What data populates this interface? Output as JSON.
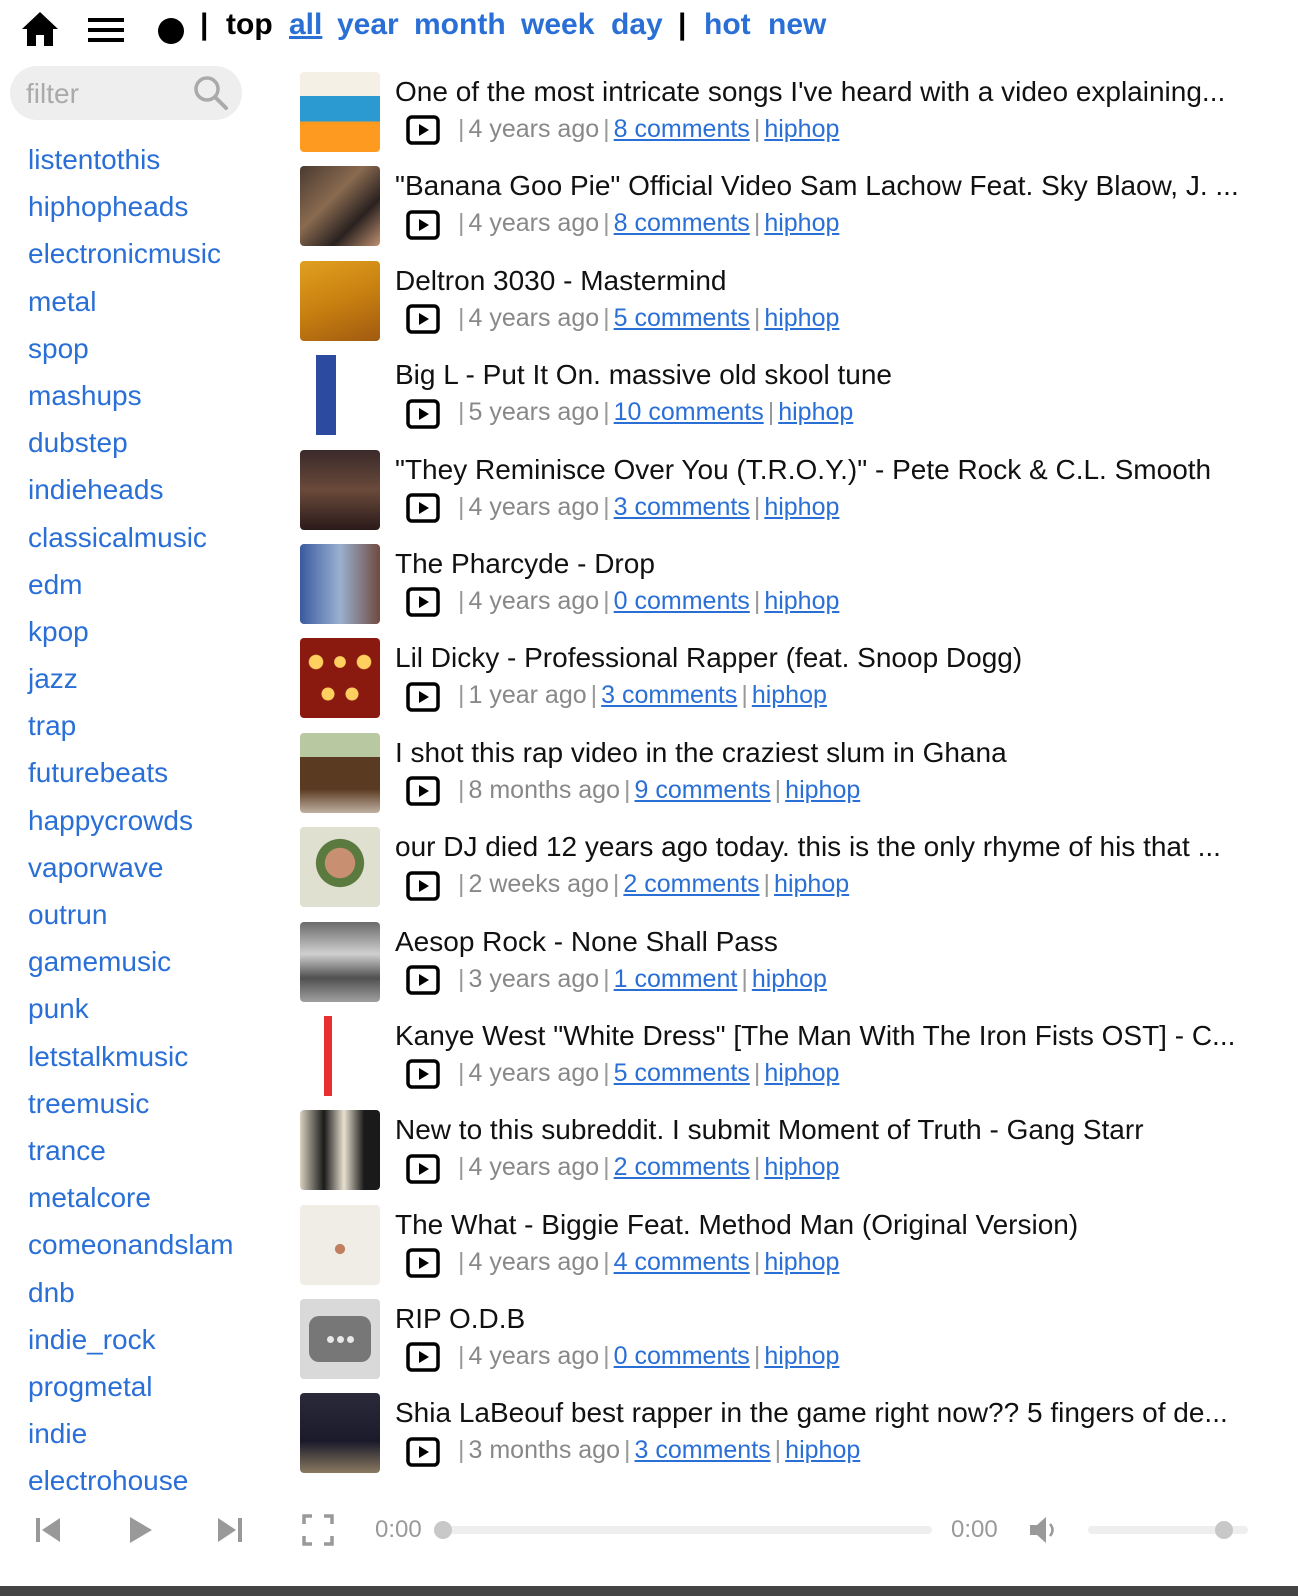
{
  "nav": {
    "separator": "|",
    "top_label": "top",
    "periods": [
      "all",
      "year",
      "month",
      "week",
      "day"
    ],
    "active_period": "all",
    "sorts": [
      "hot",
      "new"
    ]
  },
  "filter": {
    "placeholder": "filter",
    "value": ""
  },
  "subreddits": [
    "listentothis",
    "hiphopheads",
    "electronicmusic",
    "metal",
    "spop",
    "mashups",
    "dubstep",
    "indieheads",
    "classicalmusic",
    "edm",
    "kpop",
    "jazz",
    "trap",
    "futurebeats",
    "happycrowds",
    "vaporwave",
    "outrun",
    "gamemusic",
    "punk",
    "letstalkmusic",
    "treemusic",
    "trance",
    "metalcore",
    "comeonandslam",
    "dnb",
    "indie_rock",
    "progmetal",
    "indie",
    "electrohouse"
  ],
  "posts": [
    {
      "title": "One of the most intricate songs I've heard with a video explaining...",
      "age": "4 years ago",
      "comments": "8 comments",
      "sub": "hiphop"
    },
    {
      "title": "\"Banana Goo Pie\" Official Video Sam Lachow Feat. Sky Blaow, J. ...",
      "age": "4 years ago",
      "comments": "8 comments",
      "sub": "hiphop"
    },
    {
      "title": "Deltron 3030 - Mastermind",
      "age": "4 years ago",
      "comments": "5 comments",
      "sub": "hiphop"
    },
    {
      "title": "Big L - Put It On. massive old skool tune",
      "age": "5 years ago",
      "comments": "10 comments",
      "sub": "hiphop"
    },
    {
      "title": "\"They Reminisce Over You (T.R.O.Y.)\" - Pete Rock & C.L. Smooth",
      "age": "4 years ago",
      "comments": "3 comments",
      "sub": "hiphop"
    },
    {
      "title": "The Pharcyde - Drop",
      "age": "4 years ago",
      "comments": "0 comments",
      "sub": "hiphop"
    },
    {
      "title": "Lil Dicky - Professional Rapper (feat. Snoop Dogg)",
      "age": "1 year ago",
      "comments": "3 comments",
      "sub": "hiphop"
    },
    {
      "title": "I shot this rap video in the craziest slum in Ghana",
      "age": "8 months ago",
      "comments": "9 comments",
      "sub": "hiphop"
    },
    {
      "title": "our DJ died 12 years ago today. this is the only rhyme of his that ...",
      "age": "2 weeks ago",
      "comments": "2 comments",
      "sub": "hiphop"
    },
    {
      "title": "Aesop Rock - None Shall Pass",
      "age": "3 years ago",
      "comments": "1 comment",
      "sub": "hiphop"
    },
    {
      "title": "Kanye West \"White Dress\" [The Man With The Iron Fists OST] - C...",
      "age": "4 years ago",
      "comments": "5 comments",
      "sub": "hiphop"
    },
    {
      "title": "New to this subreddit. I submit Moment of Truth - Gang Starr",
      "age": "4 years ago",
      "comments": "2 comments",
      "sub": "hiphop"
    },
    {
      "title": "The What - Biggie Feat. Method Man (Original Version)",
      "age": "4 years ago",
      "comments": "4 comments",
      "sub": "hiphop"
    },
    {
      "title": "RIP O.D.B",
      "age": "4 years ago",
      "comments": "0 comments",
      "sub": "hiphop"
    },
    {
      "title": "Shia LaBeouf best rapper in the game right now?? 5 fingers of de...",
      "age": "3 months ago",
      "comments": "3 comments",
      "sub": "hiphop"
    }
  ],
  "player": {
    "elapsed": "0:00",
    "duration": "0:00",
    "progress": 0,
    "volume": 0.85
  },
  "icons": {
    "home": "home-icon",
    "menu": "hamburger-menu-icon",
    "dot": "record-dot-icon",
    "search": "search-icon",
    "play": "youtube-play-icon",
    "prev": "skip-previous-icon",
    "playpause": "play-icon",
    "next": "skip-next-icon",
    "fullscreen": "fullscreen-icon",
    "volume": "volume-icon"
  },
  "colors": {
    "link": "#2a6fd6",
    "text": "#111111",
    "muted": "#888888"
  }
}
